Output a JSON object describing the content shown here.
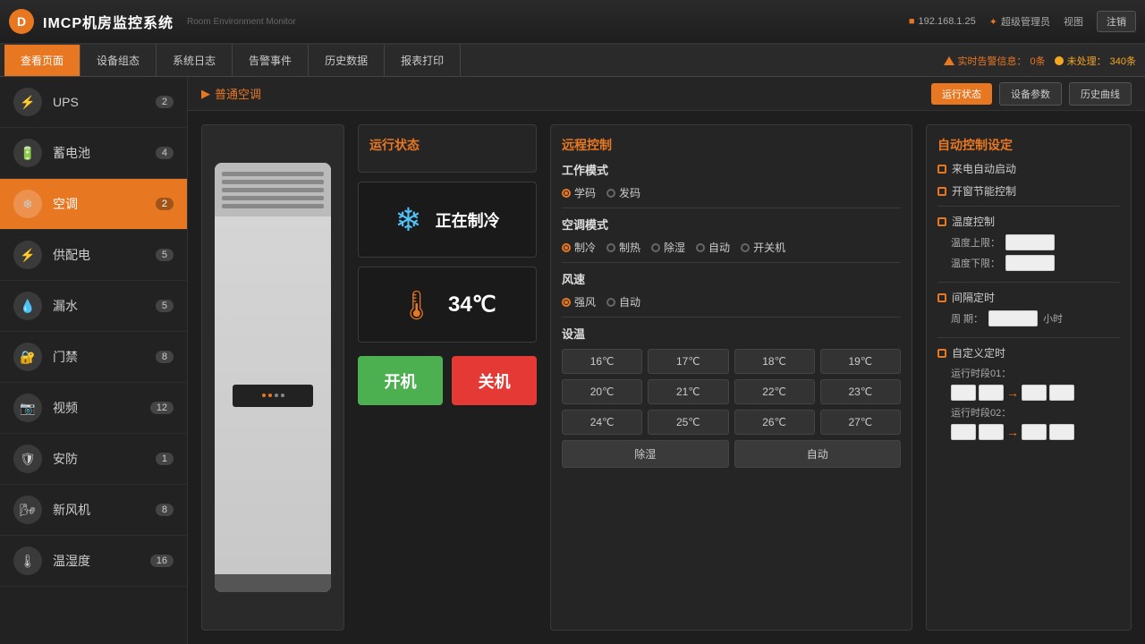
{
  "header": {
    "logo_text": "D",
    "title": "IMCP机房监控系统",
    "subtitle": "Room Environment Monitor",
    "ip": "192.168.1.25",
    "user": "超级管理员",
    "nav_label": "视图",
    "logout_label": "注销"
  },
  "navbar": {
    "tabs": [
      {
        "label": "查看页面",
        "active": true
      },
      {
        "label": "设备组态"
      },
      {
        "label": "系统日志"
      },
      {
        "label": "告警事件"
      },
      {
        "label": "历史数据"
      },
      {
        "label": "报表打印"
      }
    ],
    "alert_label": "实时告警信息：",
    "alert_count": "0条",
    "unhandled_label": "未处理：",
    "unhandled_count": "340条"
  },
  "sidebar": {
    "items": [
      {
        "label": "UPS",
        "count": "2",
        "icon": "⚡"
      },
      {
        "label": "蓄电池",
        "count": "4",
        "icon": "🔋"
      },
      {
        "label": "空调",
        "count": "2",
        "icon": "❄",
        "active": true
      },
      {
        "label": "供配电",
        "count": "5",
        "icon": "⚡"
      },
      {
        "label": "漏水",
        "count": "5",
        "icon": "💧"
      },
      {
        "label": "门禁",
        "count": "8",
        "icon": "🔐"
      },
      {
        "label": "视频",
        "count": "12",
        "icon": "📷"
      },
      {
        "label": "安防",
        "count": "1",
        "icon": "🛡"
      },
      {
        "label": "新风机",
        "count": "8",
        "icon": "🌬"
      },
      {
        "label": "温湿度",
        "count": "16",
        "icon": "🌡"
      }
    ]
  },
  "content": {
    "breadcrumb": "普通空调",
    "actions": {
      "running_status": "运行状态",
      "device_params": "设备参数",
      "history_curve": "历史曲线"
    }
  },
  "status_panel": {
    "title": "运行状态",
    "cooling_text": "正在制冷",
    "temperature": "34℃",
    "btn_on": "开机",
    "btn_off": "关机"
  },
  "remote_panel": {
    "title": "远程控制",
    "work_mode_label": "工作模式",
    "work_modes": [
      {
        "label": "学码",
        "checked": true
      },
      {
        "label": "发码"
      }
    ],
    "ac_mode_label": "空调模式",
    "ac_modes": [
      {
        "label": "制冷",
        "checked": true
      },
      {
        "label": "制热"
      },
      {
        "label": "除湿"
      },
      {
        "label": "自动"
      },
      {
        "label": "开关机"
      }
    ],
    "wind_label": "风速",
    "wind_modes": [
      {
        "label": "强风",
        "checked": true
      },
      {
        "label": "自动"
      }
    ],
    "temp_label": "设温",
    "temp_buttons": [
      "16℃",
      "17℃",
      "18℃",
      "19℃",
      "20℃",
      "21℃",
      "22℃",
      "23℃",
      "24℃",
      "25℃",
      "26℃",
      "27℃"
    ],
    "special_buttons": [
      "除湿",
      "自动"
    ]
  },
  "auto_panel": {
    "title": "自动控制设定",
    "items": [
      {
        "label": "来电自动启动"
      },
      {
        "label": "开窗节能控制"
      }
    ],
    "temp_control": {
      "label": "温度控制",
      "upper_label": "温度上限：",
      "lower_label": "温度下限："
    },
    "timer_control": {
      "label": "间隔定时",
      "period_label": "周  期：",
      "unit": "小时"
    },
    "self_timer": {
      "label": "自定义定时",
      "period1_label": "运行时段01：",
      "period2_label": "运行时段02："
    }
  }
}
